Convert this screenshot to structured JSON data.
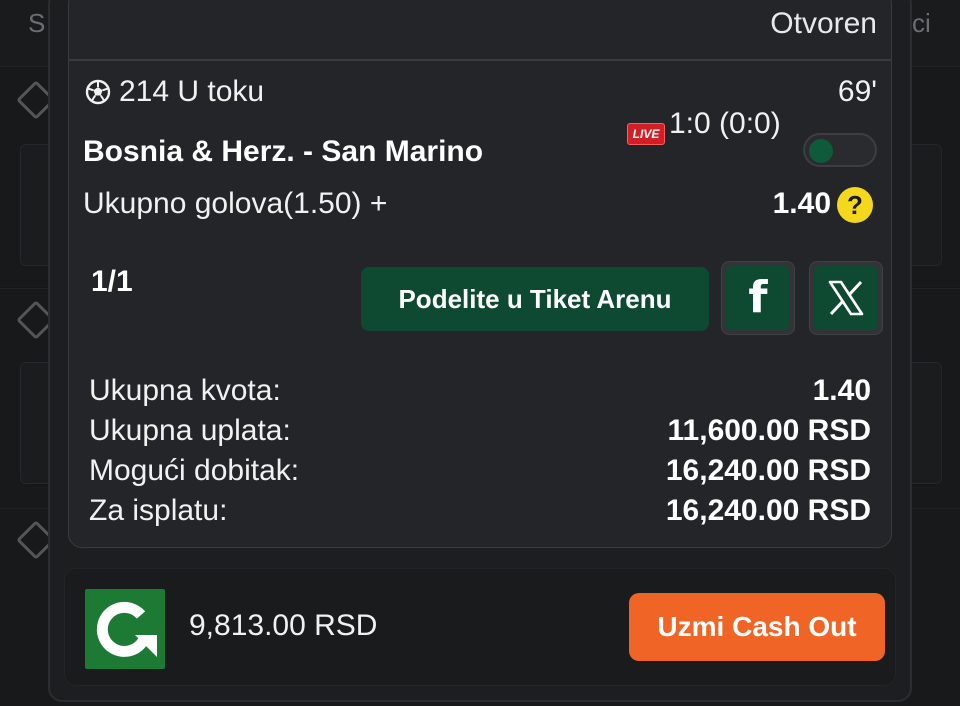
{
  "background": {
    "left_text": "S",
    "right_text": "ci"
  },
  "ticket": {
    "status": "Otvoren",
    "match_code": "214 U toku",
    "minute": "69'",
    "teams": "Bosnia & Herz. - San Marino",
    "live_badge": "LIVE",
    "score": "1:0 (0:0)",
    "market": "Ukupno golova(1.50) +",
    "odd": "1.40",
    "help_icon": "?",
    "selection_count": "1/1",
    "arena_button": "Podelite u Tiket Arenu",
    "share_facebook": "f",
    "share_x": "X"
  },
  "summary": [
    {
      "label": "Ukupna kvota:",
      "value": "1.40"
    },
    {
      "label": "Ukupna uplata:",
      "value": "11,600.00 RSD"
    },
    {
      "label": "Mogući dobitak:",
      "value": "16,240.00 RSD"
    },
    {
      "label": "Za isplatu:",
      "value": "16,240.00 RSD"
    }
  ],
  "cashout": {
    "amount": "9,813.00 RSD",
    "button": "Uzmi Cash Out"
  },
  "colors": {
    "accent_green": "#0e4a32",
    "live_red": "#d21f26",
    "cashout_orange": "#f06525",
    "help_yellow": "#f4d81c"
  }
}
